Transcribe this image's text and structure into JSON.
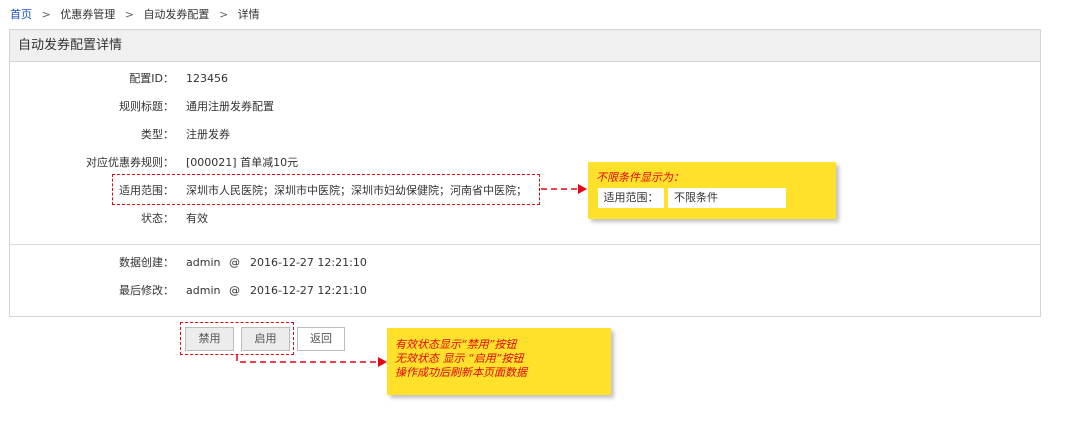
{
  "breadcrumb": {
    "home": "首页",
    "items": [
      "优惠券管理",
      "自动发券配置",
      "详情"
    ],
    "separator": ">"
  },
  "panel": {
    "title": "自动发券配置详情"
  },
  "details": {
    "config_id": {
      "label": "配置ID：",
      "value": "123456"
    },
    "rule_title": {
      "label": "规则标题：",
      "value": "通用注册发券配置"
    },
    "type": {
      "label": "类型：",
      "value": "注册发券"
    },
    "coupon_rule": {
      "label": "对应优惠券规则：",
      "value": "[000021] 首单减10元"
    },
    "scope": {
      "label": "适用范围：",
      "value": "深圳市人民医院；深圳市中医院；深圳市妇幼保健院；河南省中医院；"
    },
    "status": {
      "label": "状态：",
      "value": "有效"
    }
  },
  "audit": {
    "created": {
      "label": "数据创建：",
      "user": "admin",
      "at": "@",
      "time": "2016-12-27 12:21:10"
    },
    "modified": {
      "label": "最后修改：",
      "user": "admin",
      "at": "@",
      "time": "2016-12-27 12:21:10"
    }
  },
  "buttons": {
    "disable": "禁用",
    "enable": "启用",
    "back": "返回"
  },
  "annotations": {
    "scope_note": {
      "title": "不限条件显示为：",
      "field_label": "适用范围：",
      "field_value": "不限条件"
    },
    "button_note": {
      "lines": [
        "有效状态显示“禁用”按钮",
        "无效状态 显示 “启用”按钮",
        "操作成功后刷新本页面数据"
      ]
    }
  },
  "colors": {
    "link": "#1a4fb8",
    "annotation_red": "#e30613",
    "note_yellow": "#ffe02a",
    "panel_header_bg": "#f0f0f0"
  }
}
